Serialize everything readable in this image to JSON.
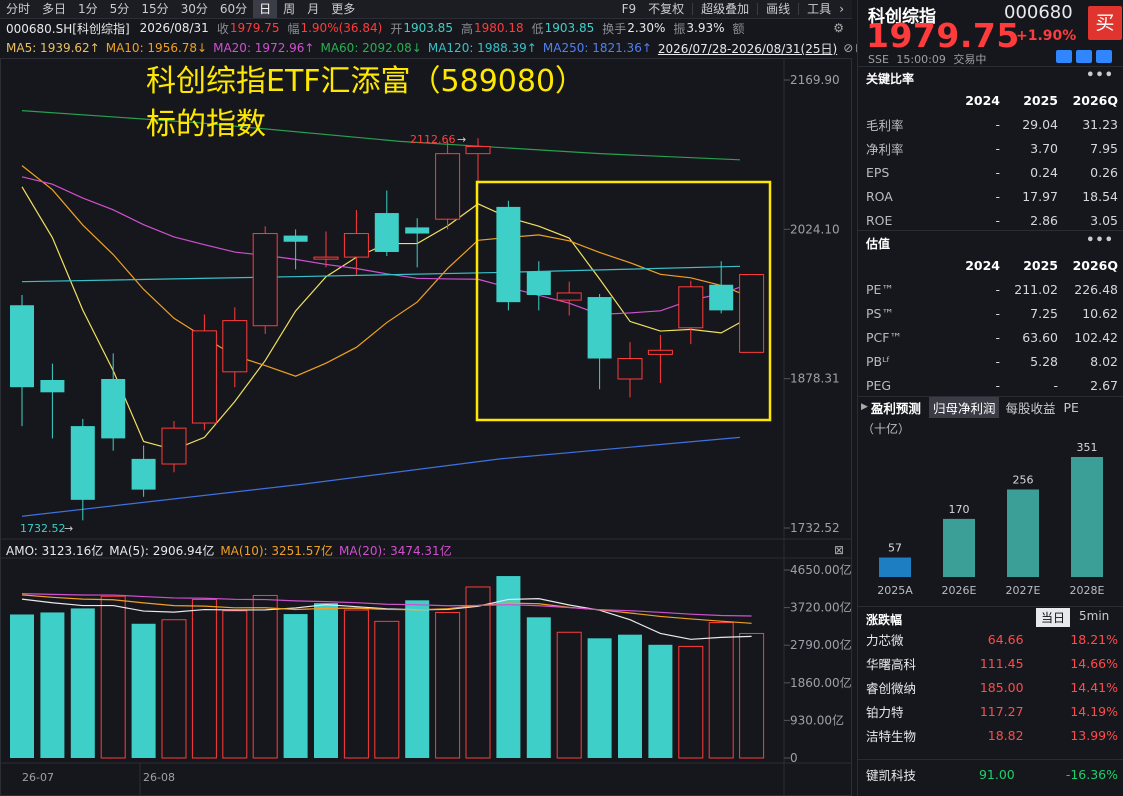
{
  "tabs": {
    "items": [
      "分时",
      "多日",
      "1分",
      "5分",
      "15分",
      "30分",
      "60分",
      "日",
      "周",
      "月",
      "更多"
    ],
    "active": "日",
    "right": [
      "F9",
      "不复权",
      "超级叠加",
      "画线",
      "工具"
    ]
  },
  "quote": {
    "code_name": "000680.SH[科创综指]",
    "date": "2026/08/31",
    "close_label": "收",
    "close": "1979.75",
    "change_label": "幅",
    "change": "1.90%(36.84)",
    "open_label": "开",
    "open": "1903.85",
    "high_label": "高",
    "high": "1980.18",
    "low_label": "低",
    "low": "1903.85",
    "turnover_label": "换手",
    "turnover": "2.30%",
    "amplitude_label": "振",
    "amplitude": "3.93%",
    "amount_label": "额"
  },
  "ma": {
    "ma5": "MA5: 1939.62↑",
    "ma10": "MA10: 1956.78↓",
    "ma20": "MA20: 1972.96↑",
    "ma60": "MA60: 2092.08↓",
    "ma120": "MA120: 1988.39↑",
    "ma250": "MA250: 1821.36↑",
    "range": "2026/07/28-2026/08/31(25日)"
  },
  "overlay": {
    "line1": "科创综指ETF汇添富（589080）",
    "line2": "标的指数"
  },
  "price_axis": [
    "2169.90",
    "2024.10",
    "1878.31",
    "1732.52"
  ],
  "annotations": {
    "high": "2112.66",
    "low": "1732.52"
  },
  "x_labels": [
    "26-07",
    "26-08"
  ],
  "amo": {
    "amo": "AMO: 3123.16亿",
    "ma5": "MA(5): 2906.94亿",
    "ma10": "MA(10): 3251.57亿",
    "ma20": "MA(20): 3474.31亿",
    "axis": [
      "4650.00亿",
      "3720.00亿",
      "2790.00亿",
      "1860.00亿",
      "930.00亿",
      "0"
    ]
  },
  "colors": {
    "up": "#ff3b3b",
    "down": "#3ed0c8",
    "ma5": "#f0e6e6",
    "ma10": "#f0a024",
    "ma20": "#d050d0",
    "ma60": "#28a050",
    "ma120": "#38c0c8",
    "ma250": "#4070e0",
    "highlight": "#ffe800"
  },
  "chart_data": {
    "type": "candlestick",
    "candles": [
      {
        "o": 1950,
        "c": 1870,
        "h": 1960,
        "l": 1832,
        "up": false
      },
      {
        "o": 1877,
        "c": 1865,
        "h": 1893,
        "l": 1820,
        "up": false
      },
      {
        "o": 1832,
        "c": 1760,
        "h": 1839,
        "l": 1740,
        "up": false
      },
      {
        "o": 1878,
        "c": 1820,
        "h": 1903,
        "l": 1808,
        "up": false
      },
      {
        "o": 1800,
        "c": 1770,
        "h": 1813,
        "l": 1763,
        "up": false
      },
      {
        "o": 1795,
        "c": 1830,
        "h": 1837,
        "l": 1787,
        "up": true
      },
      {
        "o": 1835,
        "c": 1925,
        "h": 1941,
        "l": 1828,
        "up": true
      },
      {
        "o": 1885,
        "c": 1935,
        "h": 1948,
        "l": 1870,
        "up": true
      },
      {
        "o": 1930,
        "c": 2020,
        "h": 2027,
        "l": 1922,
        "up": true
      },
      {
        "o": 2018,
        "c": 2012,
        "h": 2024,
        "l": 1985,
        "up": false
      },
      {
        "o": 1995,
        "c": 1997,
        "h": 2022,
        "l": 1987,
        "up": true
      },
      {
        "o": 1997,
        "c": 2020,
        "h": 2043,
        "l": 1980,
        "up": true
      },
      {
        "o": 2040,
        "c": 2002,
        "h": 2062,
        "l": 1998,
        "up": false
      },
      {
        "o": 2026,
        "c": 2020,
        "h": 2035,
        "l": 1987,
        "up": false
      },
      {
        "o": 2034,
        "c": 2098,
        "h": 2110,
        "l": 2024,
        "up": true
      },
      {
        "o": 2098,
        "c": 2105,
        "h": 2113,
        "l": 2069,
        "up": true
      },
      {
        "o": 2046,
        "c": 1953,
        "h": 2052,
        "l": 1945,
        "up": false
      },
      {
        "o": 1983,
        "c": 1960,
        "h": 1993,
        "l": 1945,
        "up": false
      },
      {
        "o": 1955,
        "c": 1962,
        "h": 1973,
        "l": 1940,
        "up": true
      },
      {
        "o": 1958,
        "c": 1898,
        "h": 1961,
        "l": 1868,
        "up": false
      },
      {
        "o": 1878,
        "c": 1898,
        "h": 1914,
        "l": 1860,
        "up": true
      },
      {
        "o": 1902,
        "c": 1906,
        "h": 1921,
        "l": 1874,
        "up": true
      },
      {
        "o": 1928,
        "c": 1968,
        "h": 1974,
        "l": 1912,
        "up": true
      },
      {
        "o": 1970,
        "c": 1945,
        "h": 1993,
        "l": 1942,
        "up": false
      },
      {
        "o": 1904,
        "c": 1980,
        "h": 1980,
        "l": 1904,
        "up": true
      }
    ],
    "ylim": [
      1732.52,
      2169.9
    ],
    "volume": [
      3550,
      3600,
      3700,
      4000,
      3320,
      3420,
      3920,
      3640,
      4020,
      3560,
      3830,
      3660,
      3380,
      3900,
      3600,
      4230,
      4500,
      3480,
      3110,
      2960,
      3050,
      2800,
      2760,
      3350,
      3080
    ],
    "volume_up": [
      false,
      false,
      false,
      true,
      false,
      true,
      true,
      true,
      true,
      false,
      false,
      true,
      true,
      false,
      true,
      true,
      false,
      false,
      true,
      false,
      false,
      false,
      true,
      true,
      true
    ],
    "volume_ylim": [
      0,
      4650
    ]
  },
  "right": {
    "name": "科创综指",
    "code": "000680",
    "buy": "买",
    "price": "1979.75",
    "change_pct": "+1.90%",
    "exchange": "SSE",
    "time": "15:00:09",
    "status": "交易中",
    "ratios_title": "关键比率",
    "ratios_head": [
      "",
      "2024",
      "2025",
      "2026Q"
    ],
    "ratios": [
      [
        "毛利率",
        "-",
        "29.04",
        "31.23"
      ],
      [
        "净利率",
        "-",
        "3.70",
        "7.95"
      ],
      [
        "EPS",
        "-",
        "0.24",
        "0.26"
      ],
      [
        "ROA",
        "-",
        "17.97",
        "18.54"
      ],
      [
        "ROE",
        "-",
        "2.86",
        "3.05"
      ]
    ],
    "val_title": "估值",
    "val_head": [
      "",
      "2024",
      "2025",
      "2026Q"
    ],
    "val": [
      [
        "PE™",
        "-",
        "211.02",
        "226.48"
      ],
      [
        "PS™",
        "-",
        "7.25",
        "10.62"
      ],
      [
        "PCF™",
        "-",
        "63.60",
        "102.42"
      ],
      [
        "PBᴸᶠ",
        "-",
        "5.28",
        "8.02"
      ],
      [
        "PEG",
        "-",
        "-",
        "2.67"
      ]
    ],
    "forecast_tabs": [
      "盈利预测",
      "归母净利润",
      "每股收益",
      "PE"
    ],
    "forecast_unit": "（十亿）",
    "forecast": {
      "labels": [
        "2025A",
        "2026E",
        "2027E",
        "2028E"
      ],
      "values": [
        57,
        170,
        256,
        351
      ]
    },
    "movers_title": "涨跌幅",
    "movers_tabs": [
      "当日",
      "5min"
    ],
    "movers": [
      [
        "力芯微",
        "64.66",
        "18.21%"
      ],
      [
        "华曙高科",
        "111.45",
        "14.66%"
      ],
      [
        "睿创微纳",
        "185.00",
        "14.41%"
      ],
      [
        "铂力特",
        "117.27",
        "14.19%"
      ],
      [
        "洁特生物",
        "18.82",
        "13.99%"
      ]
    ],
    "last_mover": [
      "键凯科技",
      "91.00",
      "-16.36%"
    ]
  }
}
